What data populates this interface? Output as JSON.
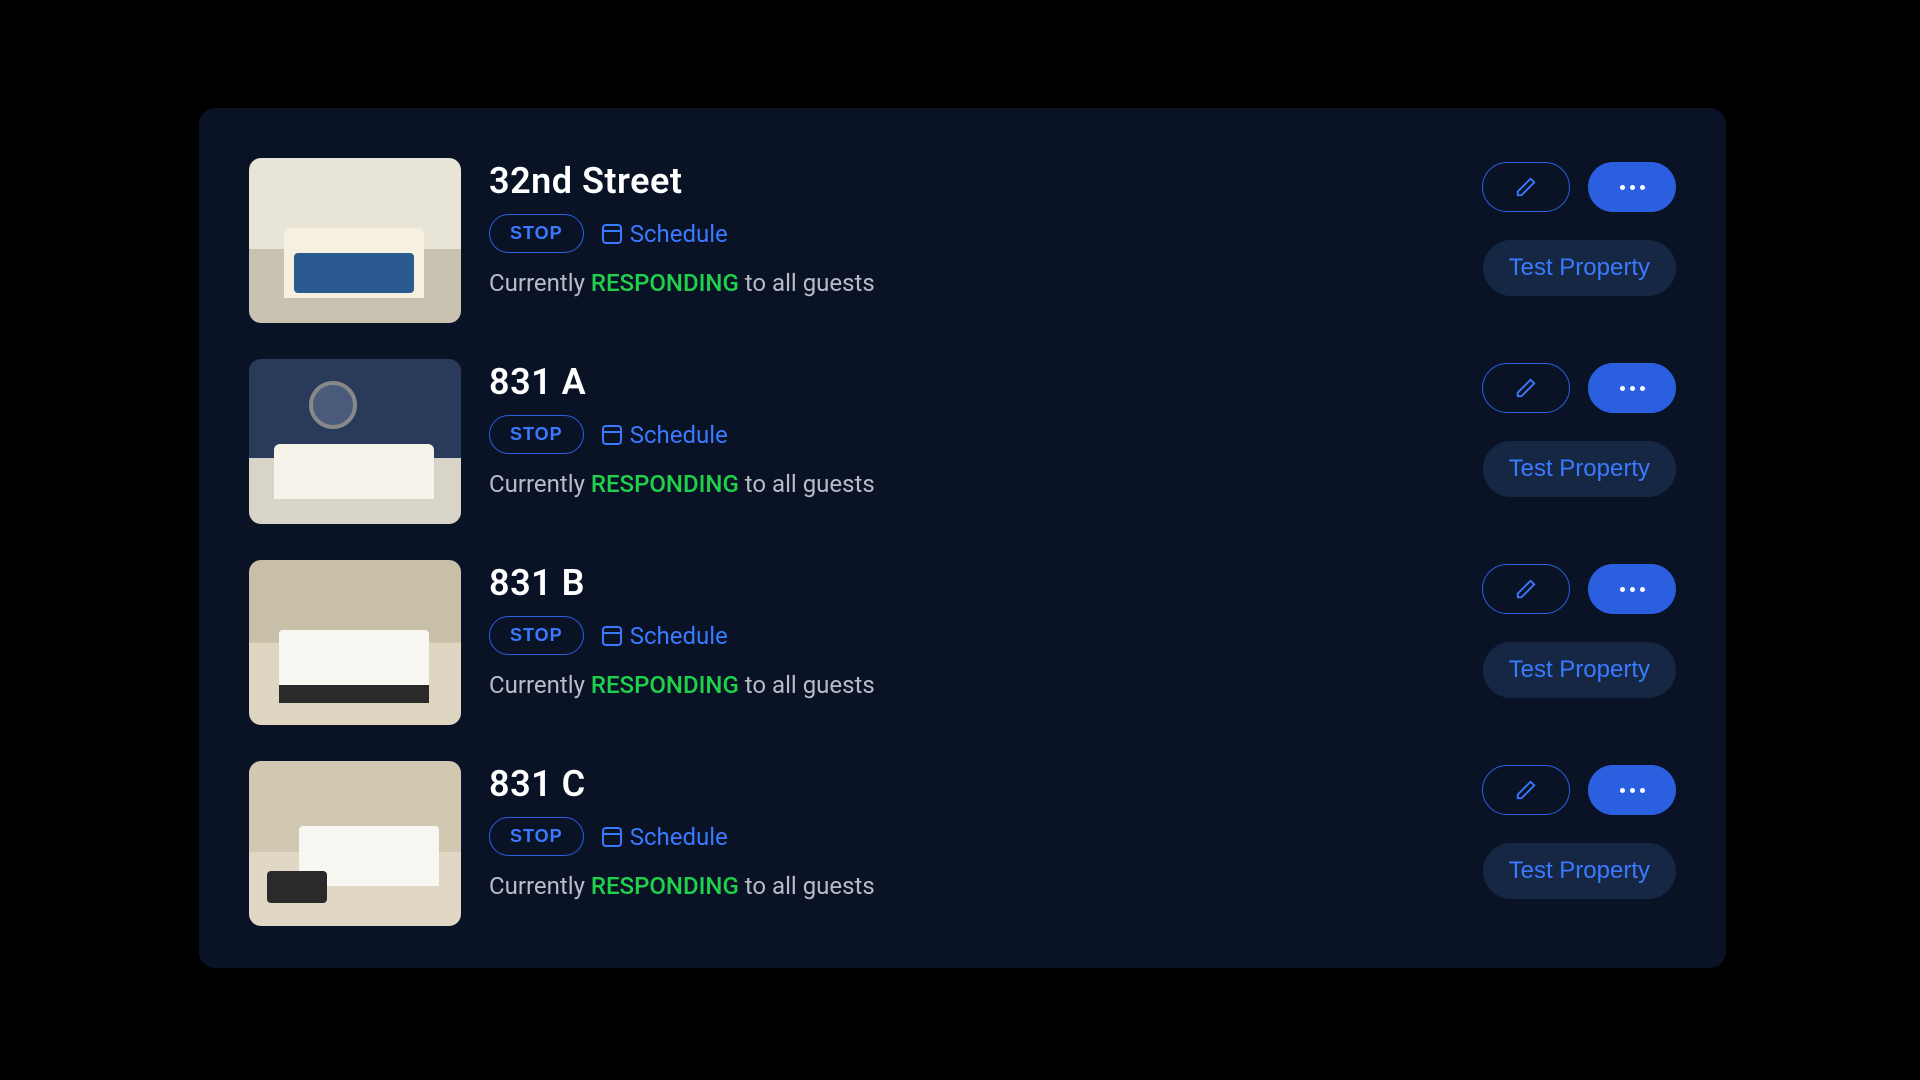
{
  "labels": {
    "stop": "STOP",
    "schedule": "Schedule",
    "test_property": "Test Property",
    "status_prefix": "Currently ",
    "status_word": "RESPONDING",
    "status_suffix": " to all guests"
  },
  "properties": [
    {
      "name": "32nd Street"
    },
    {
      "name": "831 A"
    },
    {
      "name": "831 B"
    },
    {
      "name": "831 C"
    }
  ]
}
